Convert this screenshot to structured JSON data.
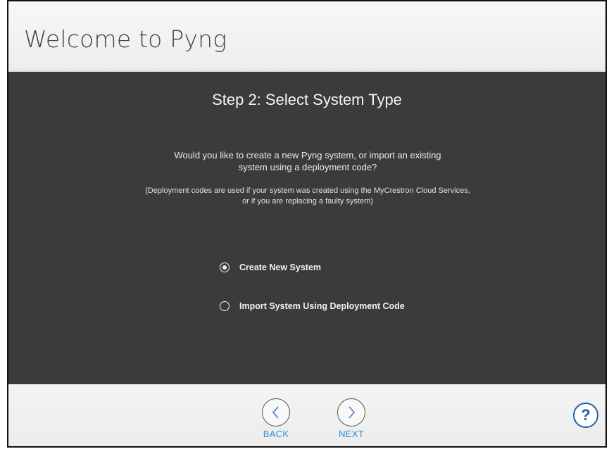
{
  "header": {
    "title": "Welcome to Pyng"
  },
  "main": {
    "step_title": "Step 2: Select System Type",
    "question_line1": "Would you like to create a new Pyng system, or import an existing",
    "question_line2": "system using a deployment code?",
    "note_line1": "(Deployment codes are used if your system was created using the MyCrestron Cloud Services,",
    "note_line2": "or if you are replacing a faulty system)",
    "options": [
      {
        "label": "Create New System",
        "selected": true
      },
      {
        "label": "Import System Using Deployment Code",
        "selected": false
      }
    ]
  },
  "footer": {
    "back_label": "BACK",
    "next_label": "NEXT",
    "help_label": "?"
  },
  "colors": {
    "panel_bg": "#3b3b3b",
    "nav_label": "#2c8fd6",
    "help_accent": "#1f5fa6"
  },
  "icons": {
    "back": "chevron-left-icon",
    "next": "chevron-right-icon",
    "help": "question-mark-icon"
  }
}
